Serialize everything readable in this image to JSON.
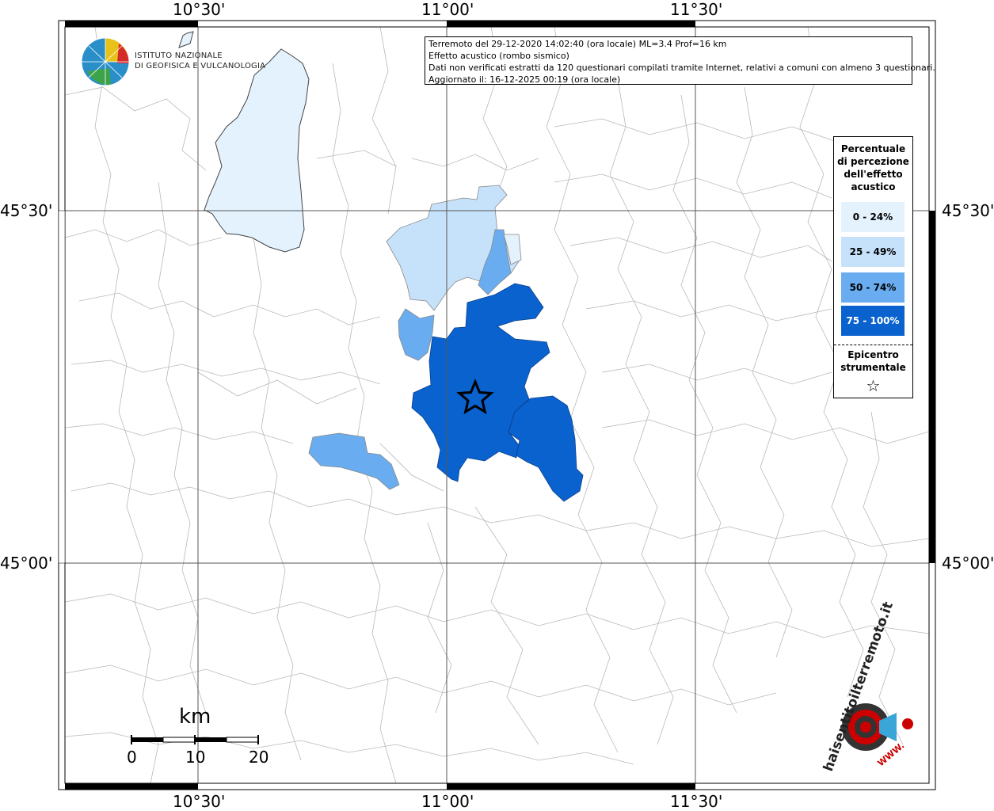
{
  "coordinates": {
    "lon_top": [
      "10°30'",
      "11°00'",
      "11°30'"
    ],
    "lon_bottom": [
      "10°30'",
      "11°00'",
      "11°30'"
    ],
    "lat_left": [
      "45°30'",
      "45°00'"
    ],
    "lat_right": [
      "45°30'",
      "45°00'"
    ]
  },
  "info": {
    "line1": "Terremoto del 29-12-2020 14:02:40 (ora locale) ML=3.4 Prof=16 km",
    "line2": "Effetto acustico (rombo sismico)",
    "line3": "Dati non verificati estratti da 120 questionari compilati tramite Internet, relativi a comuni con almeno 3 questionari.",
    "line4": "Aggiornato il: 16-12-2025 00:19 (ora locale)"
  },
  "logo": {
    "line1": "ISTITUTO NAZIONALE",
    "line2": "DI GEOFISICA E VULCANOLOGIA"
  },
  "legend": {
    "title_lines": [
      "Percentuale",
      "di percezione",
      "dell'effetto",
      "acustico"
    ],
    "items": [
      {
        "label": "0 - 24%",
        "color": "#e3f2fd"
      },
      {
        "label": "25 - 49%",
        "color": "#c6e2fb"
      },
      {
        "label": "50 - 74%",
        "color": "#69adf0"
      },
      {
        "label": "75 - 100%",
        "color": "#0a62cf",
        "text_color": "#ffffff"
      }
    ],
    "epicenter_lines": [
      "Epicentro",
      "strumentale"
    ],
    "epicenter_symbol": "☆"
  },
  "scale": {
    "title": "km",
    "labels": [
      "0",
      "10",
      "20"
    ]
  },
  "watermark": {
    "text": "haisentitoilterremoto.it",
    "url_text": "WWW."
  },
  "colors": {
    "lake": "#e3f2fd",
    "class_0_24": "#e3f2fd",
    "class_25_49": "#c6e2fb",
    "class_50_74": "#69adf0",
    "class_75_100": "#0a62cf",
    "boundary": "#b9b9b9",
    "brand_red": "#cc0000"
  }
}
